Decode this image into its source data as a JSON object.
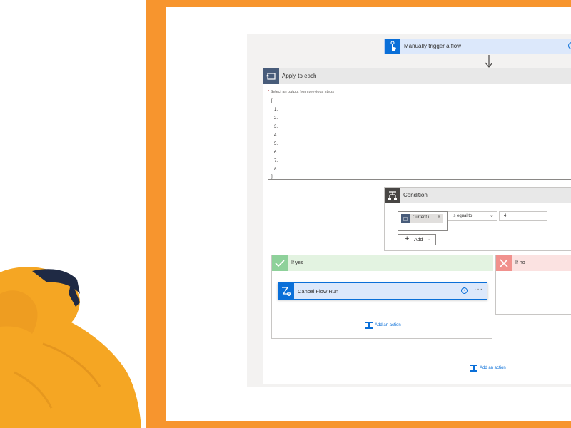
{
  "trigger": {
    "title": "Manually trigger a flow",
    "help": "?"
  },
  "apply_each": {
    "title": "Apply to each",
    "select_label_required": "*",
    "select_label": " Select an output from previous steps",
    "lines": [
      "[",
      "1.",
      "2.",
      "3.",
      "4.",
      "5.",
      "6.",
      "7.",
      "8",
      "]"
    ]
  },
  "condition": {
    "title": "Condition",
    "token_label": "Current i...",
    "token_remove": "×",
    "operator": "is equal to",
    "value": "4",
    "add_label": "Add"
  },
  "if_yes": {
    "title": "If yes",
    "action_title": "Cancel Flow Run",
    "action_help": "?",
    "action_more": "···",
    "add_action": "Add an action"
  },
  "if_no": {
    "title": "If no"
  },
  "outer_add_action": "Add an action",
  "colors": {
    "frame": "#f7952e",
    "accent_blue": "#0a6fd8",
    "yes_green": "#8ed19a",
    "no_red": "#f1918d",
    "hoodie": "#f5a623"
  },
  "icons": {
    "trigger": "hand-touch-icon",
    "apply_each": "loop-icon",
    "condition": "condition-icon",
    "yes": "checkmark-icon",
    "no": "close-icon",
    "cancel": "flow-cancel-icon",
    "add_action": "add-action-icon"
  }
}
